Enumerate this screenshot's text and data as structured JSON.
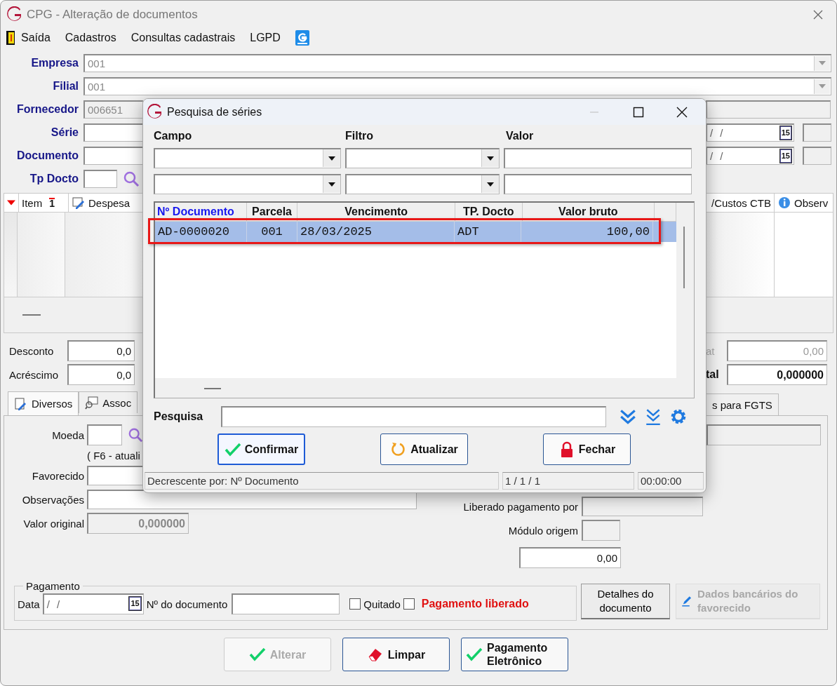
{
  "window": {
    "title": "CPG - Alteração de documentos"
  },
  "menu": [
    {
      "label": "Saída"
    },
    {
      "label": "Cadastros"
    },
    {
      "label": "Consultas cadastrais"
    },
    {
      "label": "LGPD"
    }
  ],
  "header_fields": [
    {
      "label": "Empresa",
      "value": "001",
      "kind": "combo"
    },
    {
      "label": "Filial",
      "value": "001",
      "kind": "combo"
    },
    {
      "label": "Fornecedor",
      "value": "006651",
      "kind": "readonly"
    },
    {
      "label": "Série",
      "kind": "date"
    },
    {
      "label": "Documento",
      "kind": "date"
    },
    {
      "label": "Tp Docto",
      "kind": "lookup"
    }
  ],
  "dates": [
    {
      "value": "/ /",
      "button": "15"
    },
    {
      "value": "/ /",
      "button": "15"
    }
  ],
  "grid": {
    "columns": [
      {
        "label": "Item",
        "sort": "1"
      },
      {
        "label": "Despesa"
      }
    ],
    "right_columns": [
      {
        "label": "/Custos CTB"
      },
      {
        "label": "Observ"
      }
    ]
  },
  "totals": {
    "left": [
      {
        "label": "Desconto",
        "value": "0,0"
      },
      {
        "label": "Acréscimo",
        "value": "0,0"
      }
    ],
    "right": [
      {
        "label": "at",
        "value": "0,00",
        "kind": "plain"
      },
      {
        "label": "tal",
        "value": "0,000000",
        "kind": "bold"
      }
    ]
  },
  "tabs": [
    {
      "label": "Diversos",
      "selected": true
    },
    {
      "label": "Assoc",
      "selected": false
    },
    {
      "label": "s para FGTS",
      "selected": false
    }
  ],
  "diversos": {
    "moeda": "Moeda",
    "hint": "( F6 - atuali",
    "favorecido": "Favorecido",
    "observacoes": "Observações",
    "valor_original": {
      "label": "Valor original",
      "value": "0,000000"
    },
    "liberado": "Liberado pagamento por",
    "modulo": "Módulo origem",
    "amount": "0,00"
  },
  "pagamento": {
    "title": "Pagamento",
    "date_label": "Data",
    "date_value": "/ /",
    "date_button": "15",
    "doc_label": "Nº do documento",
    "checks": [
      {
        "label": "Quitado",
        "checked": false,
        "kind": "plain"
      },
      {
        "label": "Pagamento liberado",
        "checked": false,
        "kind": "alert"
      }
    ]
  },
  "side_buttons": [
    {
      "label": "Detalhes do documento",
      "disabled": false
    },
    {
      "label": "Dados bancários do favorecido",
      "disabled": true
    }
  ],
  "actions": [
    {
      "label": "Alterar",
      "disabled": true
    },
    {
      "label": "Limpar",
      "disabled": false
    },
    {
      "label": "Pagamento Eletrônico",
      "disabled": false
    }
  ],
  "dialog": {
    "title": "Pesquisa de séries",
    "filter_headers": [
      "Campo",
      "Filtro",
      "Valor"
    ],
    "table": {
      "columns": [
        {
          "label": "Nº Documento",
          "sorted": true
        },
        {
          "label": "Parcela",
          "sorted": false
        },
        {
          "label": "Vencimento",
          "sorted": false
        },
        {
          "label": "TP. Docto",
          "sorted": false
        },
        {
          "label": "Valor bruto",
          "sorted": false
        }
      ],
      "rows": [
        {
          "cells": [
            "AD-0000020",
            "001",
            "28/03/2025",
            "ADT",
            "100,00"
          ],
          "selected": true,
          "highlighted": true
        }
      ]
    },
    "search_label": "Pesquisa",
    "buttons": [
      {
        "label": "Confirmar",
        "focused": true
      },
      {
        "label": "Atualizar",
        "focused": false
      },
      {
        "label": "Fechar",
        "focused": false
      }
    ],
    "status": [
      "Decrescente por: Nº Documento",
      "1 / 1 / 1",
      "00:00:00"
    ]
  }
}
